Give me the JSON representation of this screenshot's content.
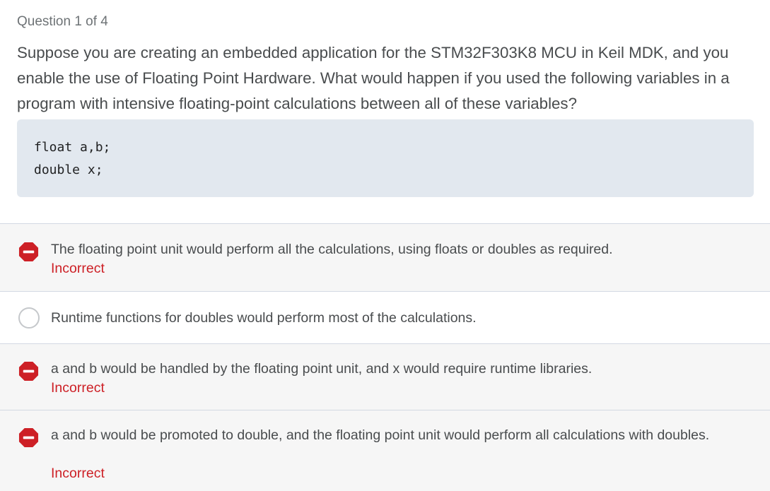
{
  "header": {
    "question_counter": "Question 1 of 4"
  },
  "question": {
    "prompt": "Suppose you are creating an embedded application for the STM32F303K8 MCU in Keil MDK, and you enable the use of Floating Point Hardware. What would happen if you used the following variables in a program with intensive floating-point calculations between all of these variables?",
    "code_lines": [
      "float a,b;",
      "double x;"
    ]
  },
  "answers": [
    {
      "text": "The floating point unit would perform all the calculations, using floats or doubles as required.",
      "status": "Incorrect",
      "state": "incorrect",
      "icon": "incorrect-icon"
    },
    {
      "text": "Runtime functions for doubles would perform most of the calculations.",
      "status": "",
      "state": "unselected",
      "icon": "radio-icon"
    },
    {
      "text": "a and b would be handled by the floating point unit, and x would require runtime libraries.",
      "status": "Incorrect",
      "state": "incorrect",
      "icon": "incorrect-icon"
    },
    {
      "text": "a and b would be promoted to double, and the floating point unit would perform all calculations with doubles.",
      "status": "Incorrect",
      "state": "incorrect",
      "icon": "incorrect-icon"
    }
  ],
  "colors": {
    "incorrect": "#cd2026",
    "code_background": "#e2e8ef",
    "divider": "#d3d9e3",
    "text": "#494c4e"
  }
}
